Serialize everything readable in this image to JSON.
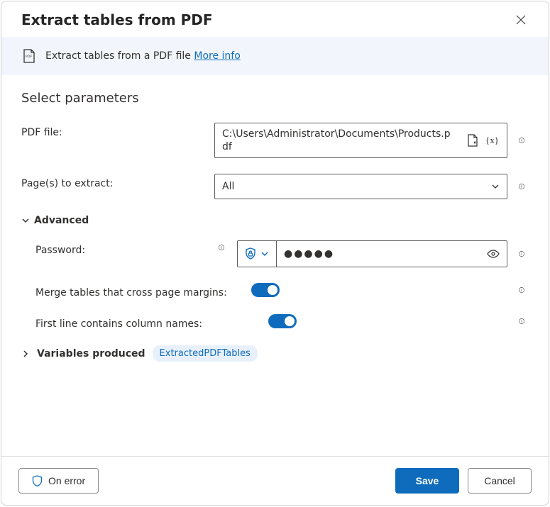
{
  "header": {
    "title": "Extract tables from PDF"
  },
  "banner": {
    "text": "Extract tables from a PDF file ",
    "more_info": "More info"
  },
  "section": {
    "title": "Select parameters"
  },
  "fields": {
    "pdf_file": {
      "label": "PDF file:",
      "value": "C:\\Users\\Administrator\\Documents\\Products.pdf"
    },
    "pages": {
      "label": "Page(s) to extract:",
      "selected": "All"
    },
    "advanced": {
      "label": "Advanced"
    },
    "password": {
      "label": "Password:",
      "masked": "●●●●●"
    },
    "merge": {
      "label": "Merge tables that cross page margins:"
    },
    "first_line": {
      "label": "First line contains column names:"
    }
  },
  "variables": {
    "label": "Variables produced",
    "produced": "ExtractedPDFTables"
  },
  "footer": {
    "on_error": "On error",
    "save": "Save",
    "cancel": "Cancel"
  }
}
